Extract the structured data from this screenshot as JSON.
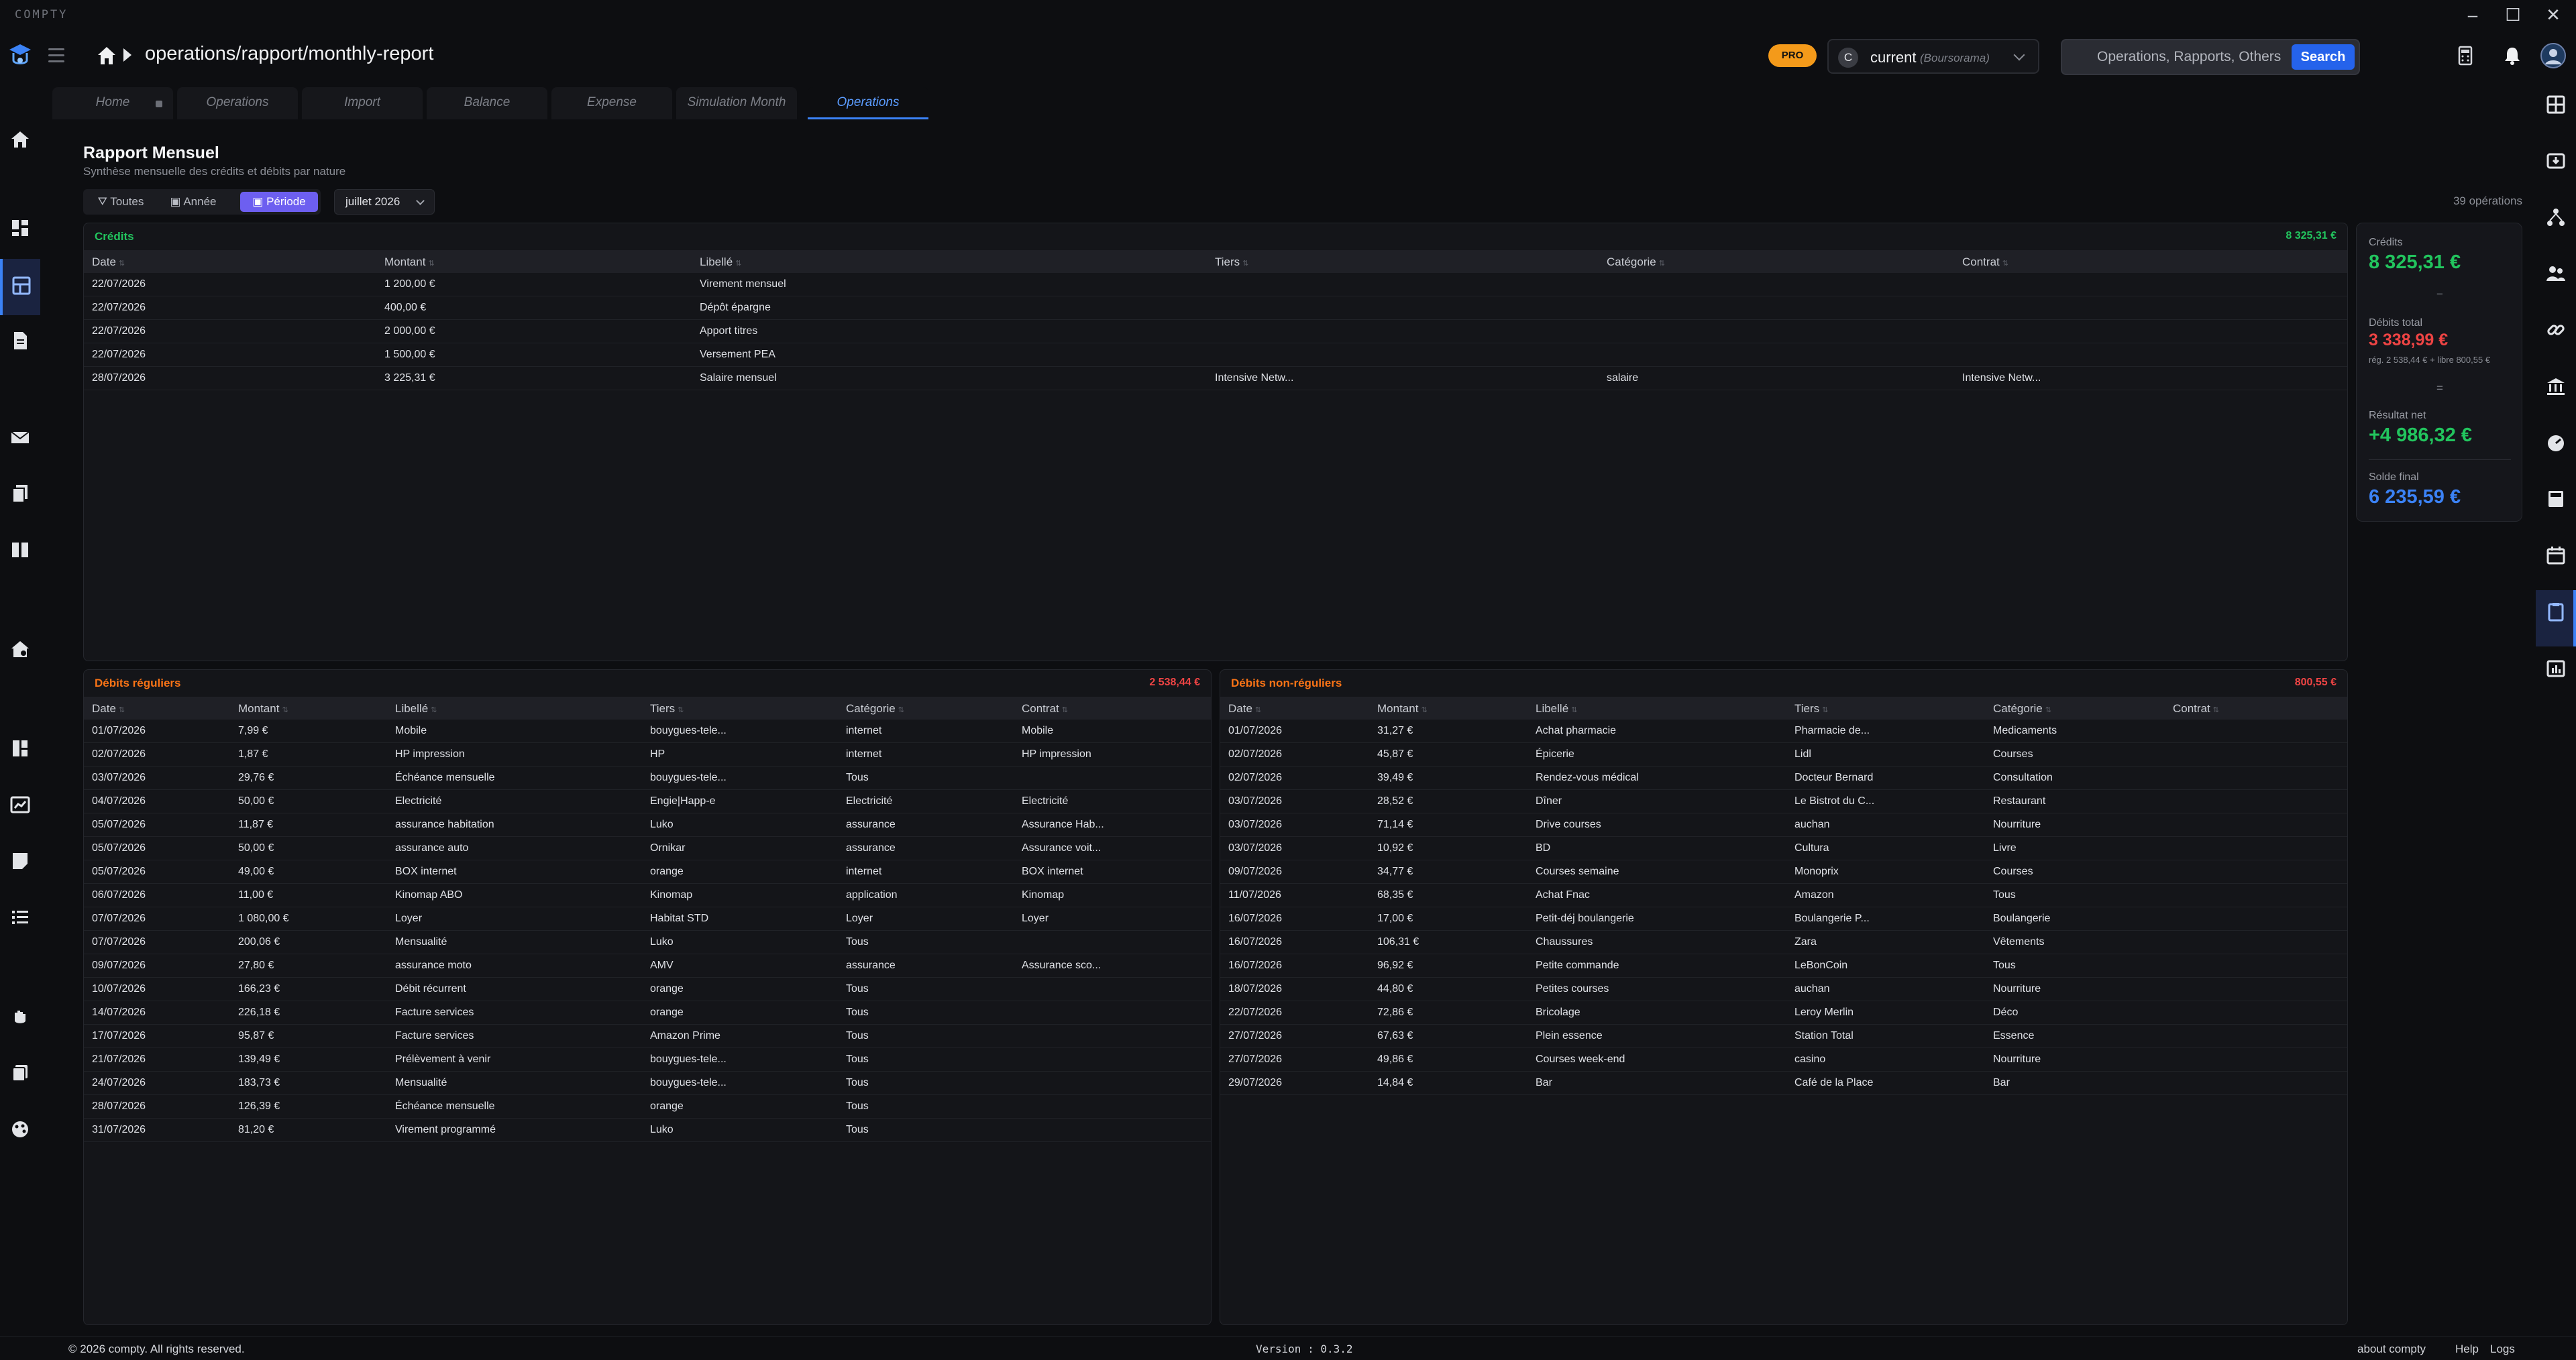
{
  "app": {
    "name": "COMPTY"
  },
  "header": {
    "breadcrumb": "operations/rapport/monthly-report",
    "pro_badge": "PRO",
    "account": {
      "initial": "C",
      "name": "current",
      "bank": "(Boursorama)"
    },
    "search": {
      "placeholder": "Operations, Rapports, Others",
      "button": "Search"
    }
  },
  "tabs": [
    {
      "label": "Home"
    },
    {
      "label": "Operations"
    },
    {
      "label": "Import"
    },
    {
      "label": "Balance"
    },
    {
      "label": "Expense"
    },
    {
      "label": "Simulation Month"
    },
    {
      "label": "Operations"
    }
  ],
  "page": {
    "title": "Rapport Mensuel",
    "subtitle": "Synthèse mensuelle des crédits et débits par nature",
    "filters": {
      "all": "Toutes",
      "year": "Année",
      "period": "Période"
    },
    "month": "juillet 2026",
    "op_count": "39 opérations"
  },
  "columns": {
    "date": "Date",
    "amount": "Montant",
    "label": "Libellé",
    "payee": "Tiers",
    "category": "Catégorie",
    "contract": "Contrat"
  },
  "credits": {
    "title": "Crédits",
    "total": "8 325,31 €",
    "rows": [
      [
        "22/07/2026",
        "1 200,00 €",
        "Virement mensuel",
        "",
        "",
        ""
      ],
      [
        "22/07/2026",
        "400,00 €",
        "Dépôt épargne",
        "",
        "",
        ""
      ],
      [
        "22/07/2026",
        "2 000,00 €",
        "Apport titres",
        "",
        "",
        ""
      ],
      [
        "22/07/2026",
        "1 500,00 €",
        "Versement PEA",
        "",
        "",
        ""
      ],
      [
        "28/07/2026",
        "3 225,31 €",
        "Salaire mensuel",
        "Intensive Netw...",
        "salaire",
        "Intensive Netw..."
      ]
    ]
  },
  "regular_debits": {
    "title": "Débits réguliers",
    "total": "2 538,44 €",
    "rows": [
      [
        "01/07/2026",
        "7,99 €",
        "Mobile",
        "bouygues-tele...",
        "internet",
        "Mobile"
      ],
      [
        "02/07/2026",
        "1,87 €",
        "HP impression",
        "HP",
        "internet",
        "HP impression"
      ],
      [
        "03/07/2026",
        "29,76 €",
        "Échéance mensuelle",
        "bouygues-tele...",
        "Tous",
        ""
      ],
      [
        "04/07/2026",
        "50,00 €",
        "Electricité",
        "Engie|Happ-e",
        "Electricité",
        "Electricité"
      ],
      [
        "05/07/2026",
        "11,87 €",
        "assurance habitation",
        "Luko",
        "assurance",
        "Assurance Hab..."
      ],
      [
        "05/07/2026",
        "50,00 €",
        "assurance auto",
        "Ornikar",
        "assurance",
        "Assurance voit..."
      ],
      [
        "05/07/2026",
        "49,00 €",
        "BOX internet",
        "orange",
        "internet",
        "BOX internet"
      ],
      [
        "06/07/2026",
        "11,00 €",
        "Kinomap ABO",
        "Kinomap",
        "application",
        "Kinomap"
      ],
      [
        "07/07/2026",
        "1 080,00 €",
        "Loyer",
        "Habitat STD",
        "Loyer",
        "Loyer"
      ],
      [
        "07/07/2026",
        "200,06 €",
        "Mensualité",
        "Luko",
        "Tous",
        ""
      ],
      [
        "09/07/2026",
        "27,80 €",
        "assurance moto",
        "AMV",
        "assurance",
        "Assurance sco..."
      ],
      [
        "10/07/2026",
        "166,23 €",
        "Débit récurrent",
        "orange",
        "Tous",
        ""
      ],
      [
        "14/07/2026",
        "226,18 €",
        "Facture services",
        "orange",
        "Tous",
        ""
      ],
      [
        "17/07/2026",
        "95,87 €",
        "Facture services",
        "Amazon Prime",
        "Tous",
        ""
      ],
      [
        "21/07/2026",
        "139,49 €",
        "Prélèvement à venir",
        "bouygues-tele...",
        "Tous",
        ""
      ],
      [
        "24/07/2026",
        "183,73 €",
        "Mensualité",
        "bouygues-tele...",
        "Tous",
        ""
      ],
      [
        "28/07/2026",
        "126,39 €",
        "Échéance mensuelle",
        "orange",
        "Tous",
        ""
      ],
      [
        "31/07/2026",
        "81,20 €",
        "Virement programmé",
        "Luko",
        "Tous",
        ""
      ]
    ]
  },
  "irregular_debits": {
    "title": "Débits non-réguliers",
    "total": "800,55 €",
    "rows": [
      [
        "01/07/2026",
        "31,27 €",
        "Achat pharmacie",
        "Pharmacie de...",
        "Medicaments",
        ""
      ],
      [
        "02/07/2026",
        "45,87 €",
        "Épicerie",
        "Lidl",
        "Courses",
        ""
      ],
      [
        "02/07/2026",
        "39,49 €",
        "Rendez-vous médical",
        "Docteur Bernard",
        "Consultation",
        ""
      ],
      [
        "03/07/2026",
        "28,52 €",
        "Dîner",
        "Le Bistrot du C...",
        "Restaurant",
        ""
      ],
      [
        "03/07/2026",
        "71,14 €",
        "Drive courses",
        "auchan",
        "Nourriture",
        ""
      ],
      [
        "03/07/2026",
        "10,92 €",
        "BD",
        "Cultura",
        "Livre",
        ""
      ],
      [
        "09/07/2026",
        "34,77 €",
        "Courses semaine",
        "Monoprix",
        "Courses",
        ""
      ],
      [
        "11/07/2026",
        "68,35 €",
        "Achat Fnac",
        "Amazon",
        "Tous",
        ""
      ],
      [
        "16/07/2026",
        "17,00 €",
        "Petit-déj boulangerie",
        "Boulangerie P...",
        "Boulangerie",
        ""
      ],
      [
        "16/07/2026",
        "106,31 €",
        "Chaussures",
        "Zara",
        "Vêtements",
        ""
      ],
      [
        "16/07/2026",
        "96,92 €",
        "Petite commande",
        "LeBonCoin",
        "Tous",
        ""
      ],
      [
        "18/07/2026",
        "44,80 €",
        "Petites courses",
        "auchan",
        "Nourriture",
        ""
      ],
      [
        "22/07/2026",
        "72,86 €",
        "Bricolage",
        "Leroy Merlin",
        "Déco",
        ""
      ],
      [
        "27/07/2026",
        "67,63 €",
        "Plein essence",
        "Station Total",
        "Essence",
        ""
      ],
      [
        "27/07/2026",
        "49,86 €",
        "Courses week-end",
        "casino",
        "Nourriture",
        ""
      ],
      [
        "29/07/2026",
        "14,84 €",
        "Bar",
        "Café de la Place",
        "Bar",
        ""
      ]
    ]
  },
  "summary": {
    "credits_label": "Crédits",
    "credits_value": "8 325,31 €",
    "minus": "−",
    "debits_label": "Débits total",
    "debits_value": "3 338,99 €",
    "debits_note": "rég. 2 538,44 € + libre 800,55 €",
    "equals": "=",
    "net_label": "Résultat net",
    "net_value": "+4 986,32 €",
    "final_label": "Solde final",
    "final_value": "6 235,59 €"
  },
  "footer": {
    "copyright": "© 2026 compty. All rights reserved.",
    "version": "Version : 0.3.2",
    "about": "about compty",
    "help": "Help",
    "logs": "Logs"
  },
  "colors": {
    "accent": "#3b82f6",
    "credit": "#22c55e",
    "debit": "#ef4444",
    "pro": "#f49a1a",
    "active_filter": "#6d5ff0"
  }
}
